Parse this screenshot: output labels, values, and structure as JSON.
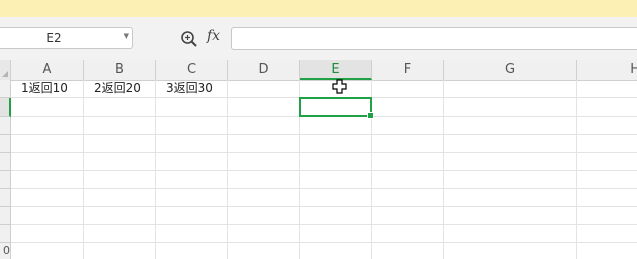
{
  "formula_bar": {
    "name_box_value": "E2",
    "zoom_icon": "zoom-formula-icon",
    "fx_label": "fx",
    "formula_value": ""
  },
  "sheet": {
    "columns": [
      "A",
      "B",
      "C",
      "D",
      "E",
      "F",
      "G",
      "H"
    ],
    "active_column": "E",
    "active_row": 2,
    "row_labels": [
      "",
      "",
      "",
      "",
      "",
      "",
      "",
      "",
      "",
      "0"
    ],
    "cells": {
      "A1": "1返回10",
      "B1": "2返回20",
      "C1": "3返回30"
    }
  },
  "colors": {
    "accent": "#21a045",
    "notice_bar": "#fdf0b5"
  },
  "cursor_icon": "plus-cross-cursor-icon"
}
